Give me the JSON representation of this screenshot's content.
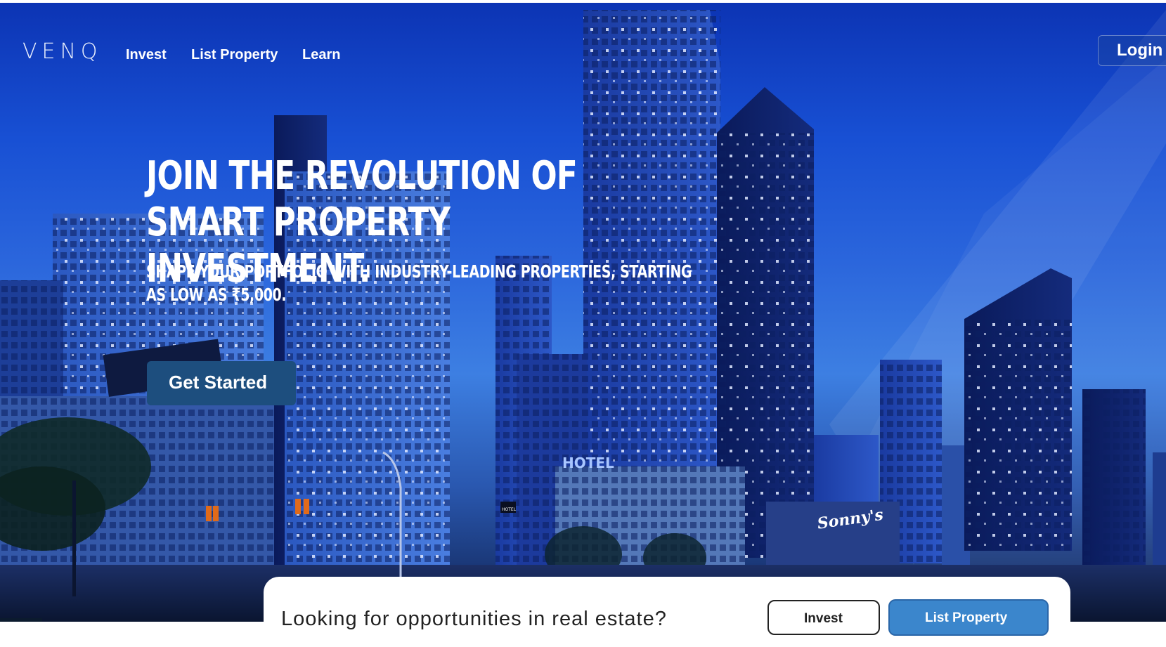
{
  "brand": {
    "logo_text": "VENQ"
  },
  "nav": {
    "items": [
      {
        "label": "Invest"
      },
      {
        "label": "List Property"
      },
      {
        "label": "Learn"
      }
    ],
    "login_label": "Login"
  },
  "hero": {
    "headline": "JOIN THE REVOLUTION OF SMART PROPERTY INVESTMENT.",
    "subline": "SHAPE YOUR PORTFOLIO WITH INDUSTRY-LEADING PROPERTIES, STARTING AS LOW AS ₹5,000.",
    "cta_label": "Get Started",
    "signs": {
      "hotel": "HOTEL",
      "small_hotel": "HOTEL",
      "sonnys": "Sonny's"
    }
  },
  "card": {
    "question": "Looking for opportunities in real estate?",
    "invest_label": "Invest",
    "list_property_label": "List Property"
  },
  "colors": {
    "cta_background": "#1d4e7e",
    "list_property_button": "#3b86cc",
    "hero_sky": "#1850d4"
  }
}
